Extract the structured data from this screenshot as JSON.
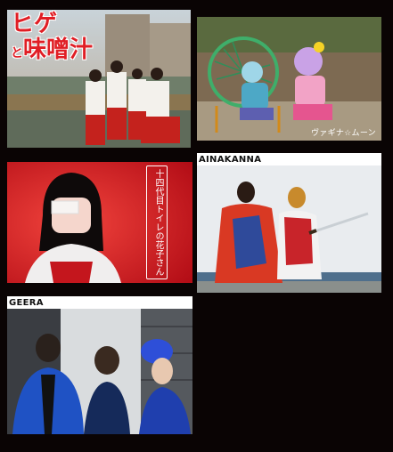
{
  "tiles": [
    {
      "id": "tile-1",
      "logo_text_line1": "ヒゲ",
      "logo_text_line2": "と",
      "logo_text_line3": "味噌汁",
      "caption": ""
    },
    {
      "id": "tile-2",
      "caption": "ヴァギナ☆ムーン"
    },
    {
      "id": "tile-3",
      "vertical_title": "十四代目トイレの花子さん"
    },
    {
      "id": "tile-4",
      "caption": "AINAKANNA"
    },
    {
      "id": "tile-5",
      "caption": "GEERA"
    }
  ],
  "colors": {
    "background": "#0a0404",
    "tile3_red": "#d9121c",
    "logo_red": "#e01e25"
  }
}
